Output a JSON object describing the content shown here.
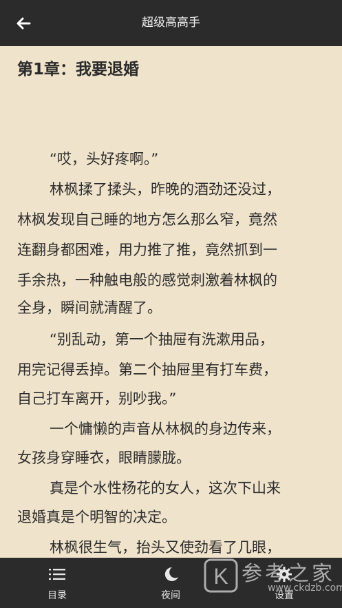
{
  "header": {
    "title": "超级高高手",
    "back_icon": "arrow-left-icon"
  },
  "chapter": {
    "title": "第1章：我要退婚"
  },
  "lines": [
    "“哎，头好疼啊。”",
    "林枫揉了揉头，昨晚的酒劲还没过，",
    "林枫发现自己睡的地方怎么那么窄，竟然",
    "连翻身都困难，用力推了推，竟然抓到一",
    "手余热，一种触电般的感觉刺激着林枫的",
    "全身，瞬间就清醒了。",
    "“别乱动，第一个抽屉有洗漱用品，",
    "用完记得丢掉。第二个抽屉里有打车费，",
    "自己打车离开，别吵我。”",
    "一个慵懒的声音从林枫的身边传来，",
    "女孩身穿睡衣，眼睛朦胧。",
    "真是个水性杨花的女人，这次下山来",
    "退婚真是个明智的决定。",
    "林枫很生气，抬头又使劲看了几眼，"
  ],
  "bottom_nav": {
    "catalog": {
      "label": "目录",
      "icon": "list-icon"
    },
    "night": {
      "label": "夜间",
      "icon": "moon-icon"
    },
    "settings": {
      "label": "设置",
      "icon": "gear-icon"
    }
  },
  "watermark": {
    "text": "参考之家",
    "url": "www.ckdzb.com",
    "letter": "K"
  },
  "colors": {
    "background": "#efe3cb",
    "bars": "#2b2b2b",
    "text": "#2c2c2c"
  }
}
